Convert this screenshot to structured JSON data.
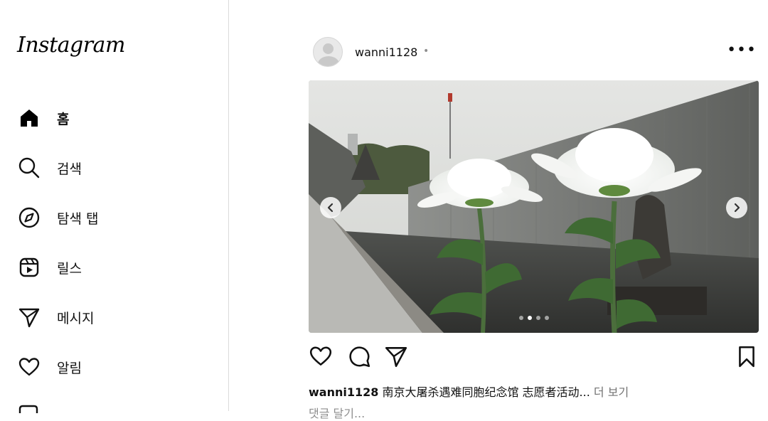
{
  "app": {
    "logo": "Instagram"
  },
  "sidebar": {
    "items": [
      {
        "label": "홈",
        "icon": "home-icon",
        "active": true
      },
      {
        "label": "검색",
        "icon": "search-icon"
      },
      {
        "label": "탐색 탭",
        "icon": "compass-icon"
      },
      {
        "label": "릴스",
        "icon": "reels-icon"
      },
      {
        "label": "메시지",
        "icon": "send-icon"
      },
      {
        "label": "알림",
        "icon": "heart-icon"
      }
    ]
  },
  "post": {
    "username": "wanni1128",
    "separator": "•",
    "more_label": "•••",
    "carousel": {
      "slide_count": 4,
      "current_index": 1
    },
    "caption_user": "wanni1128",
    "caption_text": "南京大屠杀遇难同胞纪念馆 志愿者活动...",
    "caption_more": "더 보기",
    "comments_link": "댓글 달기..."
  },
  "colors": {
    "border": "#dbdbdb",
    "text": "#262626",
    "muted": "#737373"
  }
}
